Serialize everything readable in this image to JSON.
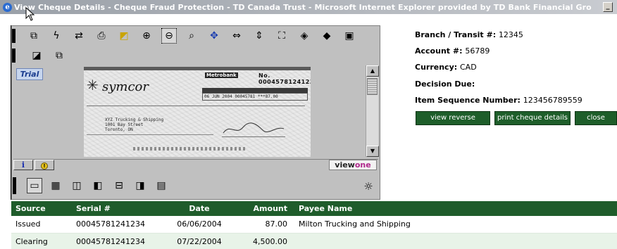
{
  "window": {
    "title": "View Cheque Details - Cheque Fraud Protection - TD Canada Trust - Microsoft Internet Explorer provided by TD Bank Financial Gro",
    "ie_icon": "e",
    "minimize": "_"
  },
  "viewer": {
    "trial_label": "Trial",
    "brand_part1": "view",
    "brand_part2": "one",
    "info_glyph": "i",
    "toolbar_row1": [
      "copy-icon",
      "lightning-icon",
      "swap-icon",
      "print-icon",
      "select-icon",
      "zoom-in-icon",
      "zoom-out-icon",
      "zoom-window-icon",
      "pan-icon",
      "fit-width-icon",
      "fit-height-icon",
      "fit-page-icon",
      "rotate-left-icon",
      "rotate-right-icon",
      "page-icon"
    ],
    "toolbar_row2": [
      "invert-icon",
      "cascade-icon"
    ],
    "view_modes": [
      "single-page-icon",
      "thumbnails-icon",
      "two-page-icon",
      "side-by-side-icon",
      "split-horizontal-icon",
      "split-vertical-icon",
      "multi-page-icon"
    ],
    "selected_tool": "zoom-out-icon",
    "selected_view": "single-page-icon"
  },
  "cheque_image": {
    "logo_text": "symcor",
    "bank_name": "Metrobank",
    "cheque_number": "No. 00045781241234",
    "info_box_text": "06 JUN 2004   00045781   ***87.00",
    "payee_address": "XYZ Trucking & Shipping\n1001 Bay Street\nToronto, ON"
  },
  "details": {
    "branch_label": "Branch / Transit #:",
    "branch_value": "12345",
    "account_label": "Account #:",
    "account_value": "56789",
    "currency_label": "Currency:",
    "currency_value": "CAD",
    "decision_label": "Decision Due:",
    "decision_value": "",
    "sequence_label": "Item Sequence Number:",
    "sequence_value": "123456789559"
  },
  "buttons": {
    "view_reverse": "view reverse",
    "print_details": "print cheque details",
    "close": "close"
  },
  "table": {
    "headers": {
      "source": "Source",
      "serial": "Serial #",
      "date": "Date",
      "amount": "Amount",
      "payee": "Payee Name"
    },
    "rows": [
      {
        "source": "Issued",
        "serial": "00045781241234",
        "date": "06/06/2004",
        "amount": "87.00",
        "payee": "Milton Trucking and Shipping"
      },
      {
        "source": "Clearing",
        "serial": "00045781241234",
        "date": "07/22/2004",
        "amount": "4,500.00",
        "payee": ""
      }
    ]
  },
  "colors": {
    "header_green": "#1f5c2b",
    "button_green": "#1e5e2a",
    "row_alt": "#e8f3e8",
    "brand_magenta": "#b0268c"
  }
}
